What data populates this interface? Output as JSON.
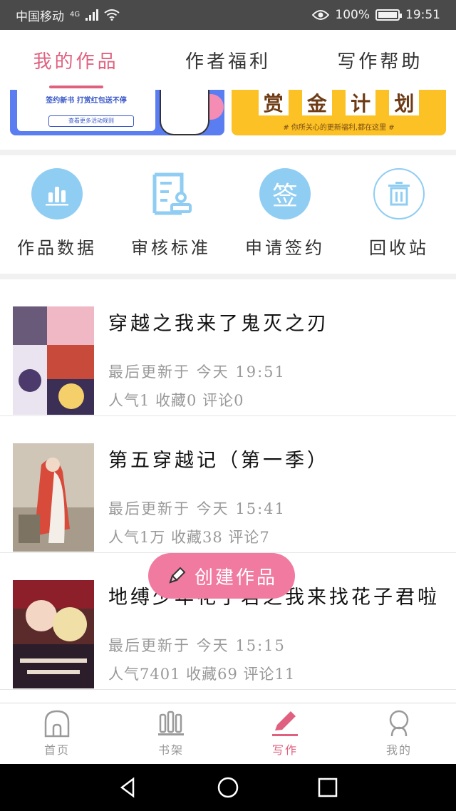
{
  "status_bar": {
    "carrier": "中国移动",
    "network": "4G",
    "battery": "100%",
    "time": "19:51"
  },
  "tabs": [
    {
      "label": "我的作品",
      "active": true
    },
    {
      "label": "作者福利",
      "active": false
    },
    {
      "label": "写作帮助",
      "active": false
    }
  ],
  "banners": {
    "left": {
      "line1": "签约新书 打赏红包送不停",
      "line2": "查看更多活动规则"
    },
    "right": {
      "chars": [
        "赏",
        "金",
        "计",
        "划"
      ],
      "sub": "# 你所关心的更新福利,都在这里 #"
    }
  },
  "tools": [
    {
      "label": "作品数据",
      "icon": "bar-chart-icon"
    },
    {
      "label": "审核标准",
      "icon": "document-review-icon"
    },
    {
      "label": "申请签约",
      "icon": "sign-icon",
      "glyph": "签"
    },
    {
      "label": "回收站",
      "icon": "trash-icon"
    }
  ],
  "works": [
    {
      "title": "穿越之我来了鬼灭之刃",
      "updated": "最后更新于 今天 19:51",
      "stats": "人气1 收藏0 评论0"
    },
    {
      "title": "第五穿越记（第一季）",
      "updated": "最后更新于 今天 15:41",
      "stats": "人气1万 收藏38 评论7"
    },
    {
      "title": "地缚少年花子君之我来找花子君啦",
      "updated": "最后更新于 今天 15:15",
      "stats": "人气7401 收藏69 评论11"
    }
  ],
  "create_button": {
    "label": "创建作品"
  },
  "bottom_nav": [
    {
      "label": "首页",
      "active": false
    },
    {
      "label": "书架",
      "active": false
    },
    {
      "label": "写作",
      "active": true
    },
    {
      "label": "我的",
      "active": false
    }
  ],
  "colors": {
    "accent": "#e0617f",
    "create_button": "#f17aa0",
    "tool_blue": "#8fcdf3",
    "banner_blue": "#5a7ef2",
    "banner_yellow": "#fcc125"
  }
}
